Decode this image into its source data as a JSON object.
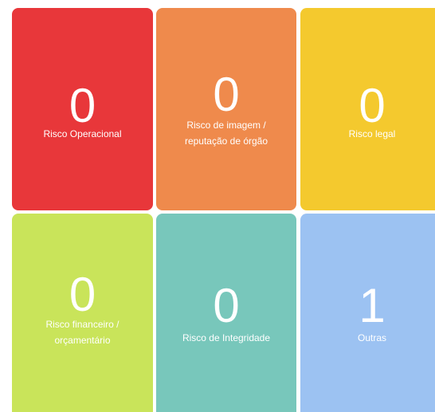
{
  "cards": [
    {
      "count": "0",
      "label": "Risco Operacional",
      "color": "#e8373a"
    },
    {
      "count": "0",
      "label_line1": "Risco de imagem /",
      "label_line2": "reputação de órgão",
      "color": "#ef8a4c"
    },
    {
      "count": "0",
      "label": "Risco legal",
      "color": "#f4c92e"
    },
    {
      "count": "0",
      "label_line1": "Risco financeiro /",
      "label_line2": "orçamentário",
      "color": "#c9e45a"
    },
    {
      "count": "0",
      "label": "Risco de Integridade",
      "color": "#78c7bb"
    },
    {
      "count": "1",
      "label": "Outras",
      "color": "#9cc2f2"
    }
  ]
}
